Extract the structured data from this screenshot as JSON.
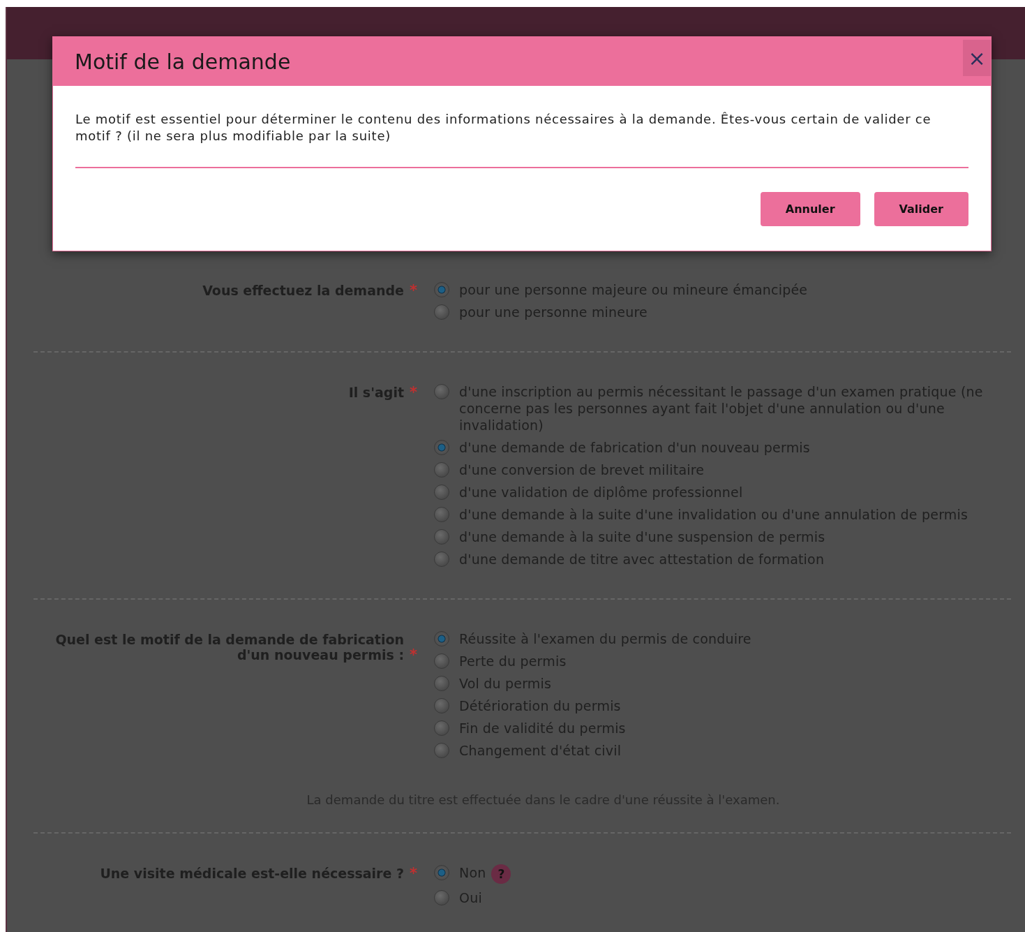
{
  "modal": {
    "title": "Motif de la demande",
    "close_label": "×",
    "message": "Le motif est essentiel pour déterminer le contenu des informations nécessaires à la demande. Êtes-vous certain de valider ce motif ? (il ne sera plus modifiable par la suite)",
    "buttons": [
      "Annuler",
      "Valider"
    ]
  },
  "form": {
    "sections": [
      {
        "label": "Vous effectuez la demande",
        "required": true,
        "options": [
          {
            "label": "pour une personne majeure ou mineure émancipée",
            "selected": true
          },
          {
            "label": "pour une personne mineure",
            "selected": false
          }
        ]
      },
      {
        "label": "Il s'agit",
        "required": true,
        "options": [
          {
            "label": "d'une inscription au permis nécessitant le passage d'un examen pratique (ne concerne pas les personnes ayant fait l'objet d'une annulation ou d'une invalidation)",
            "selected": false
          },
          {
            "label": "d'une demande de fabrication d'un nouveau permis",
            "selected": true
          },
          {
            "label": "d'une conversion de brevet militaire",
            "selected": false
          },
          {
            "label": "d'une validation de diplôme professionnel",
            "selected": false
          },
          {
            "label": "d'une demande à la suite d'une invalidation ou d'une annulation de permis",
            "selected": false
          },
          {
            "label": "d'une demande à la suite d'une suspension de permis",
            "selected": false
          },
          {
            "label": "d'une demande de titre avec attestation de formation",
            "selected": false
          }
        ]
      },
      {
        "label": "Quel est le motif de la demande de fabrication d'un nouveau permis :",
        "required": true,
        "options": [
          {
            "label": "Réussite à l'examen du permis de conduire",
            "selected": true
          },
          {
            "label": "Perte du permis",
            "selected": false
          },
          {
            "label": "Vol du permis",
            "selected": false
          },
          {
            "label": "Détérioration du permis",
            "selected": false
          },
          {
            "label": "Fin de validité du permis",
            "selected": false
          },
          {
            "label": "Changement d'état civil",
            "selected": false
          }
        ],
        "note": "La demande du titre est effectuée dans le cadre d'une réussite à l'examen."
      },
      {
        "label": "Une visite médicale est-elle nécessaire ?",
        "required": true,
        "options": [
          {
            "label": "Non",
            "selected": true,
            "help": "?"
          },
          {
            "label": "Oui",
            "selected": false
          }
        ]
      }
    ],
    "required_mark": "*"
  }
}
